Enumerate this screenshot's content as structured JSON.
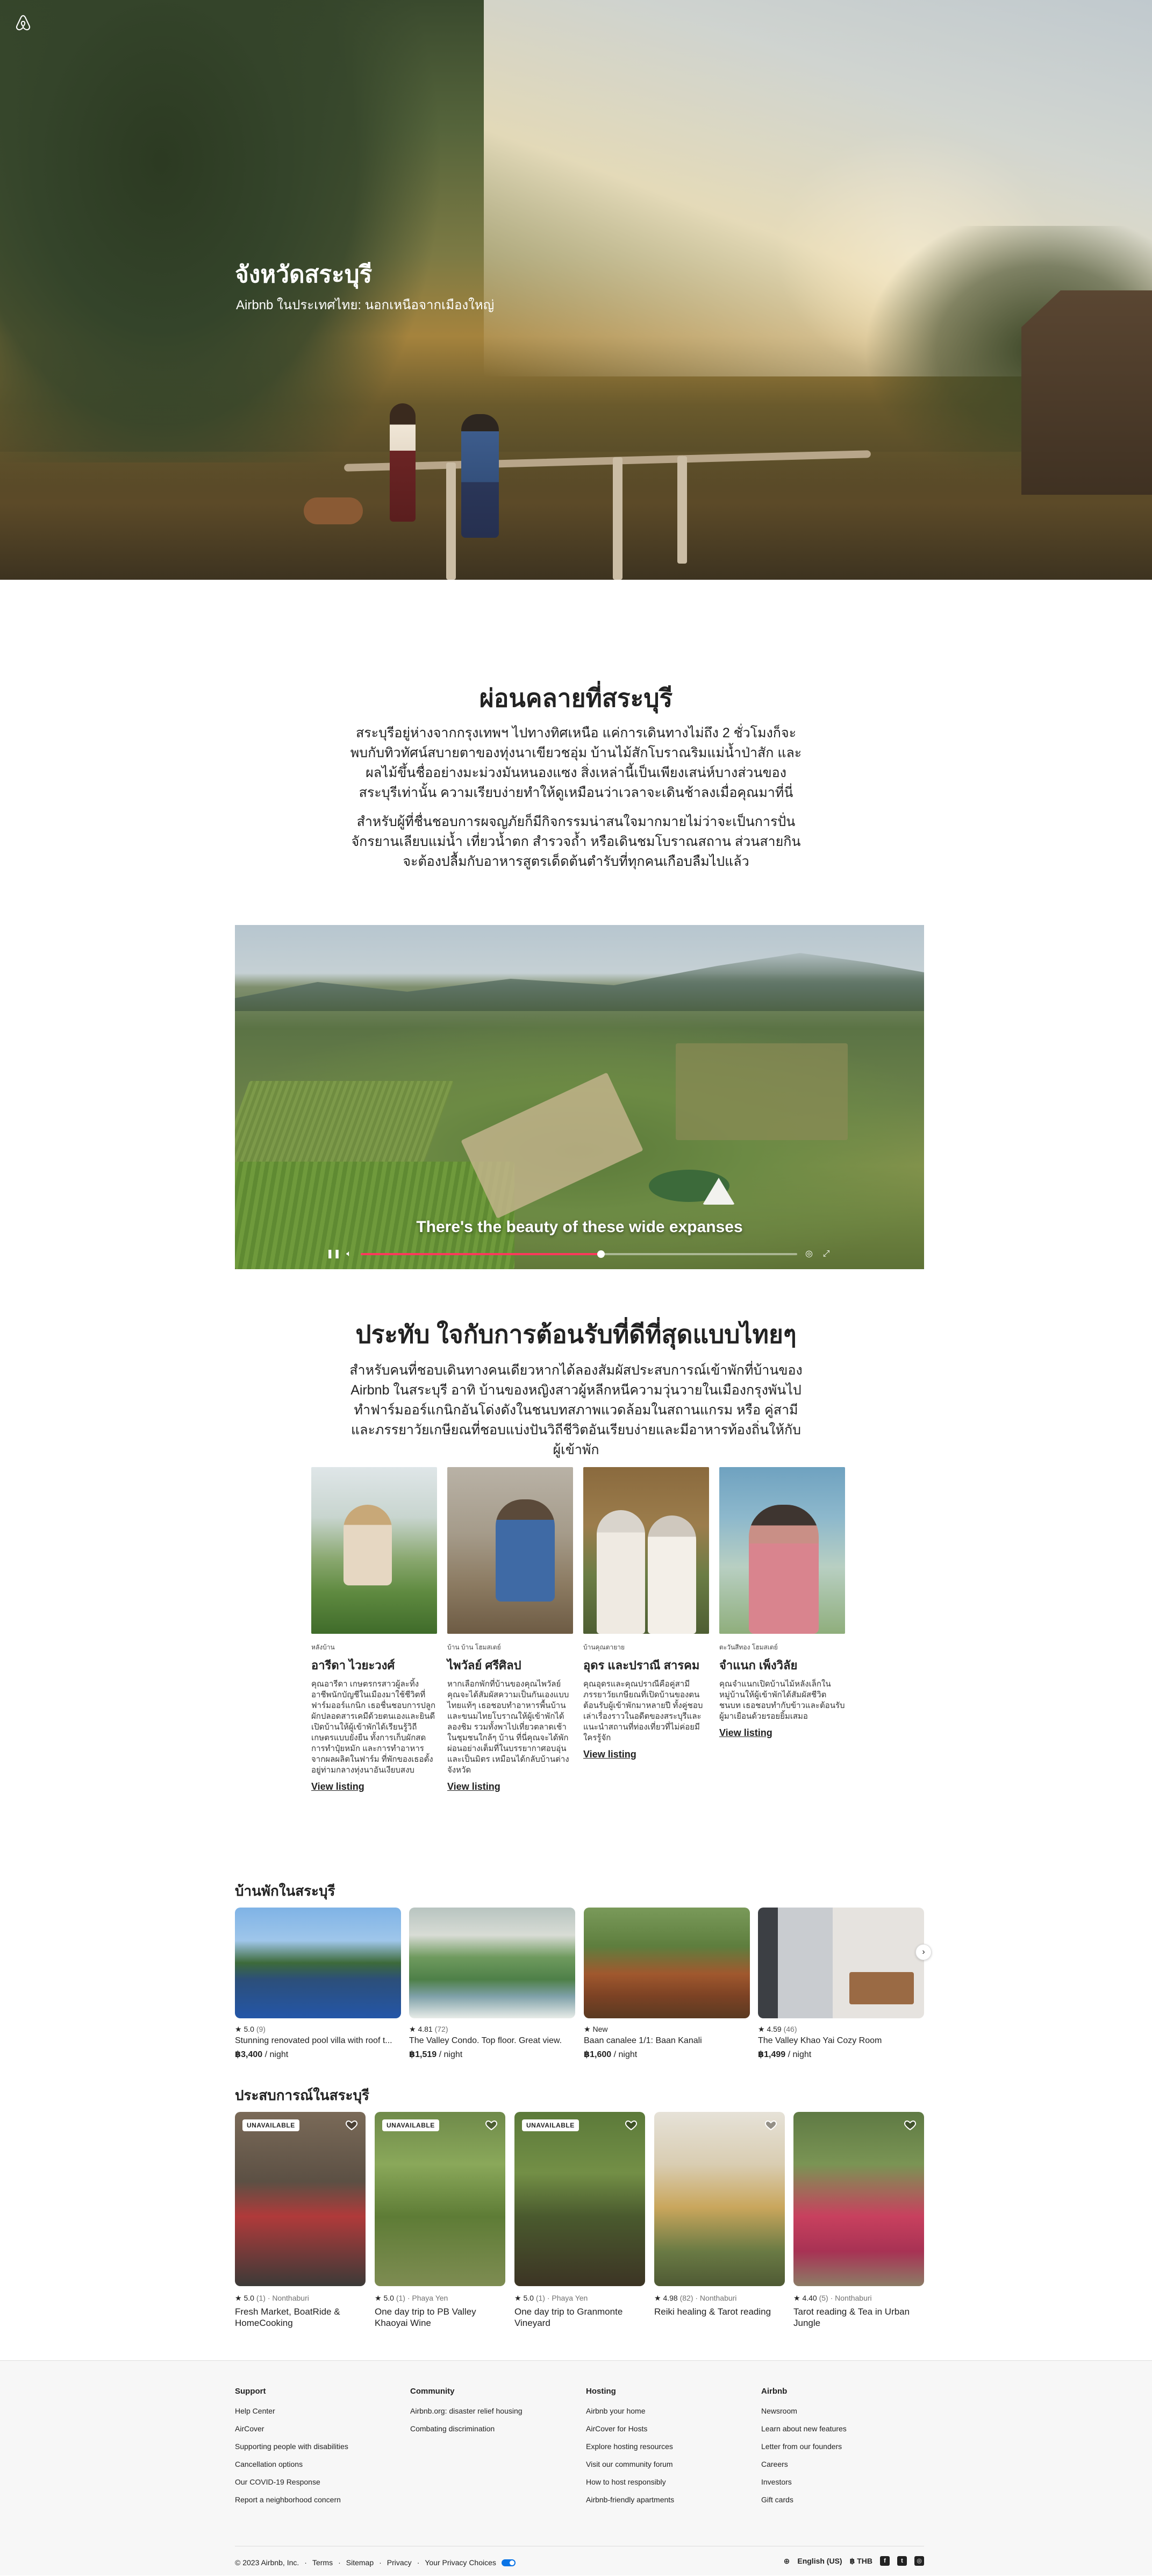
{
  "hero": {
    "title": "จังหวัดสระบุรี",
    "subtitle": "Airbnb ในประเทศไทย: นอกเหนือจากเมืองใหญ่"
  },
  "intro": {
    "title": "ผ่อนคลายที่สระบุรี",
    "para1": "สระบุรีอยู่ห่างจากกรุงเทพฯ ไปทางทิศเหนือ แค่การเดินทางไม่ถึง 2 ชั่วโมงก็จะพบกับทิวทัศน์สบายตาของทุ่งนาเขียวชอุ่ม บ้านไม้สักโบราณริมแม่น้ำป่าสัก และผลไม้ขึ้นชื่ออย่างมะม่วงมันหนองแซง สิ่งเหล่านี้เป็นเพียงเสน่ห์บางส่วนของสระบุรีเท่านั้น ความเรียบง่ายทำให้ดูเหมือนว่าเวลาจะเดินช้าลงเมื่อคุณมาที่นี่",
    "para2": "สำหรับผู้ที่ชื่นชอบการผจญภัยก็มีกิจกรรมน่าสนใจมากมายไม่ว่าจะเป็นการปั่นจักรยานเลียบแม่น้ำ เที่ยวน้ำตก สำรวจถ้ำ หรือเดินชมโบราณสถาน ส่วนสายกินจะต้องปลื้มกับอาหารสูตรเด็ดต้นตำรับที่ทุกคนเกือบลืมไปแล้ว"
  },
  "video": {
    "caption": "There's the beauty of these wide expanses",
    "progress": 0.55
  },
  "hospitality": {
    "title": "ประทับ ใจกับการต้อนรับที่ดีที่สุดแบบไทยๆ",
    "para": "สำหรับคนที่ชอบเดินทางคนเดียวหากได้ลองสัมผัสประสบการณ์เข้าพักที่บ้านของ Airbnb ในสระบุรี อาทิ บ้านของหญิงสาวผู้หลีกหนีความวุ่นวายในเมืองกรุงพันไป ทำฟาร์มออร์แกนิกอันโด่งดังในชนบทสภาพแวดล้อมในสถานแกรม หรือ คู่สามีและภรรยาวัยเกษียณที่ชอบแบ่งปันวิถีชีวิตอันเรียบง่ายและมีอาหารท้องถิ่นให้กับผู้เข้าพัก"
  },
  "hosts": [
    {
      "role": "หลังบ้าน",
      "name": "อารีดา ไวยะวงศ์",
      "desc": "คุณอารีดา เกษตรกรสาวผู้ละทิ้งอาชีพนักบัญชีในเมืองมาใช้ชีวิตที่ฟาร์มออร์แกนิก เธอชื่นชอบการปลูกผักปลอดสารเคมีด้วยตนเองและยินดีเปิดบ้านให้ผู้เข้าพักได้เรียนรู้วิถีเกษตรแบบยั่งยืน ทั้งการเก็บผักสด การทำปุ๋ยหมัก และการทำอาหารจากผลผลิตในฟาร์ม ที่พักของเธอตั้งอยู่ท่ามกลางทุ่งนาอันเงียบสงบ",
      "link": "View listing"
    },
    {
      "role": "บ้าน บ้าน โฮมสเตย์",
      "name": "ไพวัลย์ ศรีศิลป",
      "desc": "หากเลือกพักที่บ้านของคุณไพวัลย์ คุณจะได้สัมผัสความเป็นกันเองแบบไทยแท้ๆ เธอชอบทำอาหารพื้นบ้านและขนมไทยโบราณให้ผู้เข้าพักได้ลองชิม รวมทั้งพาไปเที่ยวตลาดเช้าในชุมชนใกล้ๆ บ้าน ที่นี่คุณจะได้พักผ่อนอย่างเต็มที่ในบรรยากาศอบอุ่นและเป็นมิตร เหมือนได้กลับบ้านต่างจังหวัด",
      "link": "View listing"
    },
    {
      "role": "บ้านคุณตายาย",
      "name": "อุดร และปราณี สารคม",
      "desc": "คุณอุดรและคุณปราณีคือคู่สามีภรรยาวัยเกษียณที่เปิดบ้านของตนต้อนรับผู้เข้าพักมาหลายปี ทั้งคู่ชอบเล่าเรื่องราวในอดีตของสระบุรีและแนะนำสถานที่ท่องเที่ยวที่ไม่ค่อยมีใครรู้จัก",
      "link": "View listing"
    },
    {
      "role": "ตะวันสีทอง โฮมสเตย์",
      "name": "จำแนก เพ็งวิลัย",
      "desc": "คุณจำแนกเปิดบ้านไม้หลังเล็กในหมู่บ้านให้ผู้เข้าพักได้สัมผัสชีวิตชนบท เธอชอบทำกับข้าวและต้อนรับผู้มาเยือนด้วยรอยยิ้มเสมอ",
      "link": "View listing"
    }
  ],
  "stays": {
    "title": "บ้านพักในสระบุรี",
    "items": [
      {
        "rating": "5.0",
        "reviews": "(9)",
        "title": "Stunning renovated pool villa with roof t...",
        "price": "฿3,400",
        "per": "/ night"
      },
      {
        "rating": "4.81",
        "reviews": "(72)",
        "title": "The Valley Condo. Top floor. Great view.",
        "price": "฿1,519",
        "per": "/ night"
      },
      {
        "rating": "New",
        "reviews": "",
        "title": "Baan canalee 1/1: Baan Kanali",
        "price": "฿1,600",
        "per": "/ night"
      },
      {
        "rating": "4.59",
        "reviews": "(46)",
        "title": "The Valley Khao Yai Cozy Room",
        "price": "฿1,499",
        "per": "/ night"
      }
    ]
  },
  "experiences": {
    "title": "ประสบการณ์ในสระบุรี",
    "items": [
      {
        "badge": "UNAVAILABLE",
        "rating": "5.0",
        "meta": "(1) · Nonthaburi",
        "title": "Fresh Market, BoatRide & HomeCooking"
      },
      {
        "badge": "UNAVAILABLE",
        "rating": "5.0",
        "meta": "(1) · Phaya Yen",
        "title": "One day trip to PB Valley Khaoyai Wine"
      },
      {
        "badge": "UNAVAILABLE",
        "rating": "5.0",
        "meta": "(1) · Phaya Yen",
        "title": "One day trip to Granmonte Vineyard"
      },
      {
        "badge": "",
        "rating": "4.98",
        "meta": "(82) · Nonthaburi",
        "title": "Reiki healing & Tarot reading"
      },
      {
        "badge": "",
        "rating": "4.40",
        "meta": "(5) · Nonthaburi",
        "title": "Tarot reading & Tea in Urban Jungle"
      }
    ]
  },
  "footer": {
    "support": {
      "title": "Support",
      "links": [
        "Help Center",
        "AirCover",
        "Supporting people with disabilities",
        "Cancellation options",
        "Our COVID-19 Response",
        "Report a neighborhood concern"
      ]
    },
    "community": {
      "title": "Community",
      "links": [
        "Airbnb.org: disaster relief housing",
        "Combating discrimination"
      ]
    },
    "hosting": {
      "title": "Hosting",
      "links": [
        "Airbnb your home",
        "AirCover for Hosts",
        "Explore hosting resources",
        "Visit our community forum",
        "How to host responsibly",
        "Airbnb-friendly apartments"
      ]
    },
    "airbnb": {
      "title": "Airbnb",
      "links": [
        "Newsroom",
        "Learn about new features",
        "Letter from our founders",
        "Careers",
        "Investors",
        "Gift cards"
      ]
    },
    "copyright": "© 2023 Airbnb, Inc.",
    "terms": "Terms",
    "sitemap": "Sitemap",
    "privacy": "Privacy",
    "choices": "Your Privacy Choices",
    "language": "English (US)",
    "currency": "฿ THB"
  },
  "colors": {
    "brand": "#ff385c",
    "text": "#222222",
    "muted": "#717171",
    "footer_bg": "#f7f7f7"
  }
}
